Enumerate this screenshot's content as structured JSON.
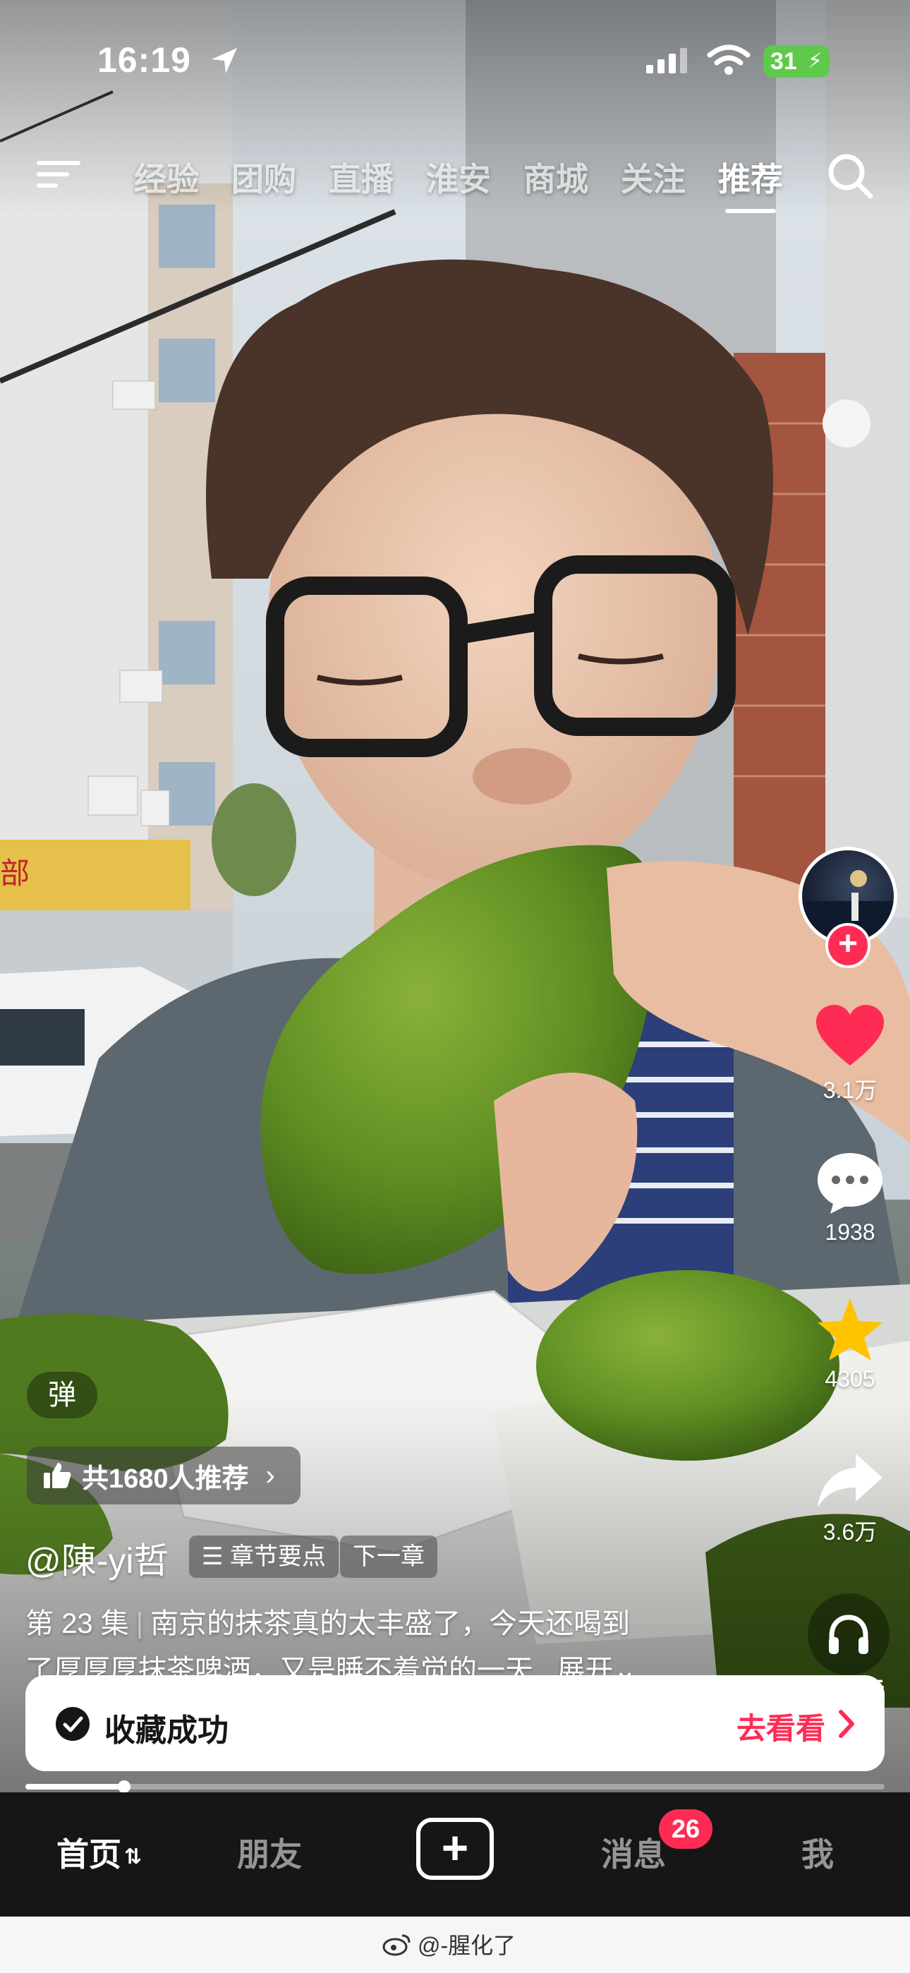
{
  "status_bar": {
    "time": "16:19",
    "battery": "31"
  },
  "top_nav": {
    "tabs": [
      {
        "label": "经验",
        "active": false
      },
      {
        "label": "团购",
        "active": false
      },
      {
        "label": "直播",
        "active": false
      },
      {
        "label": "淮安",
        "active": false
      },
      {
        "label": "商城",
        "active": false
      },
      {
        "label": "关注",
        "active": false
      },
      {
        "label": "推荐",
        "active": true
      }
    ]
  },
  "rail": {
    "likes": "3.1万",
    "comments": "1938",
    "favorites": "4305",
    "shares": "3.6万",
    "listen_label": "听抖音"
  },
  "caption": {
    "danmu_label": "弹",
    "recommend_text": "共1680人推荐",
    "author": "@陳-yi哲",
    "chapter_chip": "章节要点",
    "next_chip": "下一章",
    "episode": "第 23 集",
    "text_line1": "南京的抹茶真的太丰盛了，今天还喝到",
    "text_line2": "了厚厚厚抹茶啤酒，又是睡不着觉的一天...",
    "expand": "展开"
  },
  "toast": {
    "message": "收藏成功",
    "action": "去看看"
  },
  "progress": {
    "fraction": 0.115
  },
  "bottom_nav": {
    "home": "首页",
    "friends": "朋友",
    "messages": "消息",
    "messages_badge": "26",
    "me": "我"
  },
  "watermark": {
    "text": "@-腥化了"
  },
  "colors": {
    "accent": "#fe2c55",
    "star": "#ffc300",
    "bar_bg": "#161616"
  }
}
